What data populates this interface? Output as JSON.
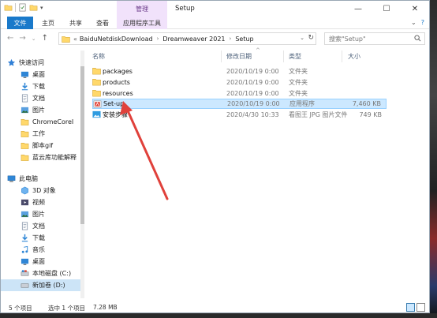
{
  "window": {
    "title": "Setup",
    "context_tab": "管理",
    "minimize": "—",
    "maximize": "☐",
    "close": "✕"
  },
  "ribbon": {
    "tabs": [
      "文件",
      "主页",
      "共享",
      "查看",
      "应用程序工具"
    ],
    "help": "?"
  },
  "address": {
    "crumbs": [
      "BaiduNetdiskDownload",
      "Dreamweaver 2021",
      "Setup"
    ],
    "chevron": "«"
  },
  "search": {
    "placeholder": "搜索\"Setup\""
  },
  "nav": {
    "quick_access": "快速访问",
    "items": [
      {
        "label": "桌面",
        "pinned": true
      },
      {
        "label": "下载",
        "pinned": true
      },
      {
        "label": "文档",
        "pinned": true
      },
      {
        "label": "图片",
        "pinned": true
      },
      {
        "label": "ChromeCoreI",
        "pinned": false
      },
      {
        "label": "工作",
        "pinned": false
      },
      {
        "label": "脚本gif",
        "pinned": false
      },
      {
        "label": "蓝云库功能解释",
        "pinned": false
      }
    ],
    "this_pc": "此电脑",
    "pc_items": [
      "3D 对象",
      "视频",
      "图片",
      "文档",
      "下载",
      "音乐",
      "桌面",
      "本地磁盘 (C:)",
      "新加卷 (D:)"
    ]
  },
  "columns": {
    "name": "名称",
    "date": "修改日期",
    "type": "类型",
    "size": "大小"
  },
  "files": [
    {
      "name": "packages",
      "date": "2020/10/19 0:00",
      "type": "文件夹",
      "size": "",
      "kind": "folder"
    },
    {
      "name": "products",
      "date": "2020/10/19 0:00",
      "type": "文件夹",
      "size": "",
      "kind": "folder"
    },
    {
      "name": "resources",
      "date": "2020/10/19 0:00",
      "type": "文件夹",
      "size": "",
      "kind": "folder"
    },
    {
      "name": "Set-up",
      "date": "2020/10/19 0:00",
      "type": "应用程序",
      "size": "7,460 KB",
      "kind": "app"
    },
    {
      "name": "安装步骤",
      "date": "2020/4/30 10:33",
      "type": "看图王 JPG 图片文件",
      "size": "749 KB",
      "kind": "image"
    }
  ],
  "status": {
    "count": "5 个项目",
    "selected": "选中 1 个项目",
    "size": "7.28 MB"
  },
  "colors": {
    "accent": "#1979ca",
    "selection": "#cce8ff",
    "context_tab": "#f1e2fb",
    "folder": "#ffd86b",
    "arrow": "#e0413b"
  }
}
